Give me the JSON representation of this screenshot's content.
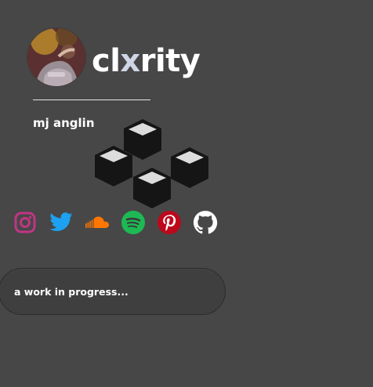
{
  "header": {
    "title_prefix": "cl",
    "title_accent": "x",
    "title_suffix": "rity"
  },
  "author": "mj anglin",
  "social": [
    {
      "name": "instagram",
      "icon": "instagram-icon",
      "color": "#c13584"
    },
    {
      "name": "twitter",
      "icon": "twitter-icon",
      "color": "#1da1f2"
    },
    {
      "name": "soundcloud",
      "icon": "soundcloud-icon",
      "color": "#ff7700"
    },
    {
      "name": "spotify",
      "icon": "spotify-icon",
      "color": "#1db954"
    },
    {
      "name": "pinterest",
      "icon": "pinterest-icon",
      "color": "#bd081c"
    },
    {
      "name": "github",
      "icon": "github-icon",
      "color": "#ffffff"
    }
  ],
  "status_pill": {
    "label": "a work in progress..."
  },
  "colors": {
    "background": "#474747",
    "text": "#ffffff",
    "pill": "#3f3f3f"
  }
}
